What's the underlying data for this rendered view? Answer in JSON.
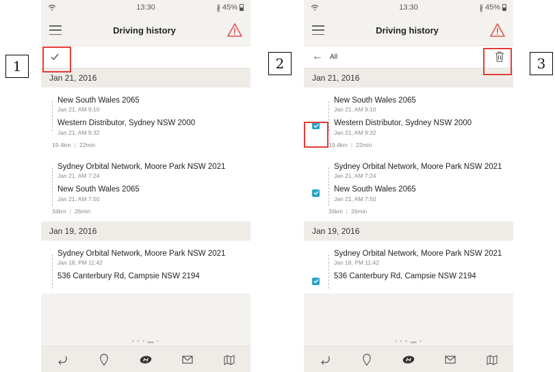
{
  "callouts": [
    "1",
    "2",
    "3"
  ],
  "status": {
    "time": "13:30",
    "battery": "45%"
  },
  "header": {
    "title": "Driving history"
  },
  "toolbar": {
    "all_label": "All"
  },
  "colors": {
    "accent": "#2aa4c8",
    "warning": "#d9534f",
    "callout_highlight": "#e53935"
  },
  "groups": [
    {
      "date": "Jan 21, 2016",
      "trips": [
        {
          "from": "New South Wales 2065",
          "from_time": "Jan 21, AM 9:10",
          "to": "Western Distributor, Sydney NSW 2000",
          "to_time": "Jan 21, AM 9:32",
          "distance": "19.4km",
          "duration": "22min"
        },
        {
          "from": "Sydney Orbital Network, Moore Park NSW 2021",
          "from_time": "Jan 21, AM 7:24",
          "to": "New South Wales 2065",
          "to_time": "Jan 21, AM 7:50",
          "distance": "34km",
          "duration": "26min"
        }
      ]
    },
    {
      "date": "Jan 19, 2016",
      "trips": [
        {
          "from": "Sydney Orbital Network, Moore Park NSW 2021",
          "from_time": "Jan 18, PM 11:42",
          "to": "536 Canterbury Rd, Campsie NSW 2194"
        }
      ]
    }
  ],
  "bottom_nav": [
    "back-arrow-icon",
    "location-pin-icon",
    "hyundai-logo-icon",
    "mail-icon",
    "map-icon"
  ]
}
